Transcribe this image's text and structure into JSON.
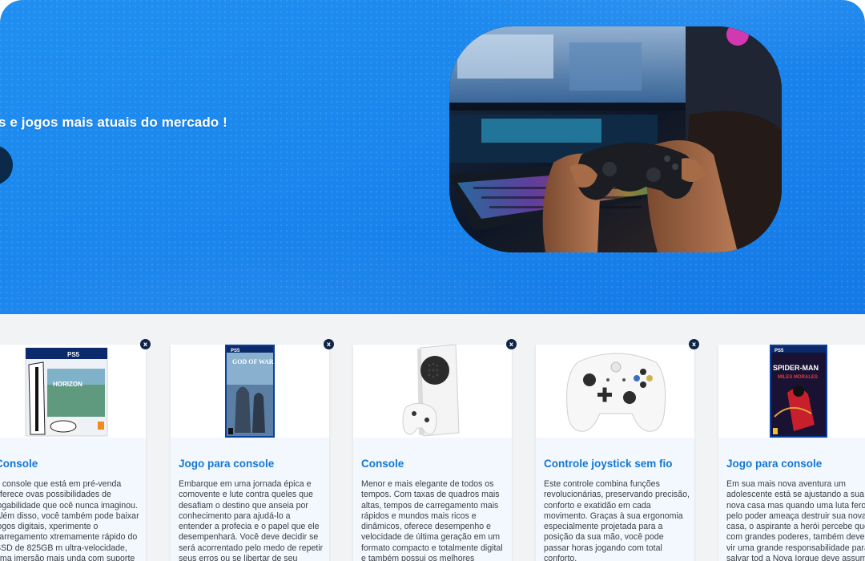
{
  "hero": {
    "tagline": "s e jogos mais atuais do mercado !",
    "image_icon": "gamer-controller-photo"
  },
  "products": [
    {
      "image_icon": "ps5-horizon-bundle",
      "title": "Console",
      "description": "e console que está em pré-venda oferece ovas possibilidades de jogabilidade que ocê nunca imaginou. Além disso, você também pode baixar jogos digitais, xperimente o carregamento xtremamente rápido do SSD de 825GB m ultra-velocidade, uma imersão mais unda com suporte à resposta tátil"
    },
    {
      "image_icon": "god-of-war-ps5-case",
      "title": "Jogo para console",
      "description": "Embarque em uma jornada épica e comovente e lute contra queles que desafiam o destino que anseia por conhecimento para ajudá-lo a entender a profecia e o papel que ele desempenhará. Você deve decidir se será acorrentado pelo medo de repetir seus erros ou se libertar de seu passado para ser o pai que"
    },
    {
      "image_icon": "xbox-series-s-console",
      "title": "Console",
      "description": "Menor e mais elegante de todos os tempos. Com taxas de quadros mais altas, tempos de carregamento mais rápidos e mundos mais ricos e dinâmicos, oferece desempenho e velocidade de última geração em um formato compacto e totalmente digital e também possui os melhores serviços para jogadores de"
    },
    {
      "image_icon": "xbox-wireless-controller",
      "title": "Controle joystick sem fio",
      "description": "Este controle combina funções revolucionárias, preservando precisão, conforto e exatidão em cada movimento. Graças à sua ergonomia especialmente projetada para a posição da sua mão, você pode passar horas jogando com total conforto."
    },
    {
      "image_icon": "spider-man-miles-morales-case",
      "title": "Jogo para console",
      "description": "Em sua mais nova aventura um adolescente está se ajustando a sua nova casa mas quando uma luta feroz pelo poder ameaça destruir sua nova casa, o aspirante a herói percebe que com grandes poderes, também deve vir uma grande responsabilidade para salvar tod a Nova Iorque deve assumir o manto"
    }
  ],
  "close_label": "x",
  "colors": {
    "hero_blue": "#1a86ee",
    "title_blue": "#1577d4",
    "close_navy": "#0f2545",
    "card_bg": "#f2f8fe"
  }
}
